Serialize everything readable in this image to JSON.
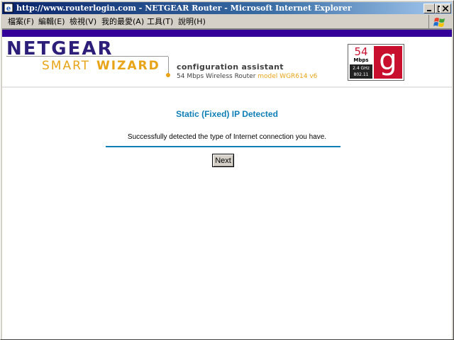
{
  "window": {
    "title": "http://www.routerlogin.com - NETGEAR Router - Microsoft Internet Explorer"
  },
  "menu": [
    {
      "label": "檔案(F)"
    },
    {
      "label": "編輯(E)"
    },
    {
      "label": "檢視(V)"
    },
    {
      "label": "我的最愛(A)"
    },
    {
      "label": "工具(T)"
    },
    {
      "label": "說明(H)"
    }
  ],
  "header": {
    "logo_netgear": "NETGEAR",
    "logo_smart": "SMART",
    "logo_wizard": "WIZARD",
    "config_title": "configuration assistant",
    "config_sub": "54 Mbps Wireless Router",
    "config_model": "model WGR614 v6",
    "badge_speed": "54",
    "badge_unit": "Mbps",
    "badge_freq": "2.4 GHz",
    "badge_std": "802.11",
    "badge_letter": "g"
  },
  "main": {
    "heading": "Static (Fixed) IP Detected",
    "message": "Successfully detected the type of Internet connection you have.",
    "next_label": "Next"
  },
  "colors": {
    "title_bar": "#0a246a",
    "brand_bar": "#330099",
    "heading": "#0e7fb6",
    "badge_red": "#c8102e",
    "accent_orange": "#e8a416"
  },
  "icons": {
    "app": "ie-page-icon",
    "minimize": "minimize-icon",
    "maximize": "maximize-icon",
    "close": "close-icon",
    "throbber": "windows-flag-icon"
  }
}
